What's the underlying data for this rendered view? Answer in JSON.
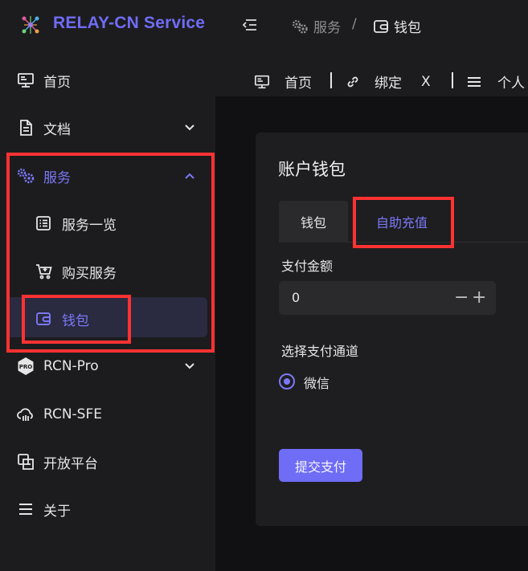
{
  "header": {
    "brand": "RELAY-CN Service",
    "breadcrumb": [
      {
        "label": "服务",
        "icon": "gears-icon"
      },
      {
        "label": "钱包",
        "icon": "wallet-icon"
      }
    ],
    "separator": "/"
  },
  "sidebar": {
    "items": [
      {
        "label": "首页",
        "icon": "monitor-icon"
      },
      {
        "label": "文档",
        "icon": "document-icon",
        "expanded": false
      },
      {
        "label": "服务",
        "icon": "gears-icon",
        "expanded": true,
        "highlighted": true
      },
      {
        "label": "服务一览",
        "icon": "list-icon",
        "sub": true
      },
      {
        "label": "购买服务",
        "icon": "cart-icon",
        "sub": true
      },
      {
        "label": "钱包",
        "icon": "wallet-icon",
        "sub": true,
        "active": true
      },
      {
        "label": "RCN-Pro",
        "icon": "pro-badge-icon",
        "expanded": false
      },
      {
        "label": "RCN-SFE",
        "icon": "cloud-icon"
      },
      {
        "label": "开放平台",
        "icon": "platform-icon"
      },
      {
        "label": "关于",
        "icon": "menu-icon"
      }
    ]
  },
  "tabs_bar": {
    "tabs": [
      {
        "label": "首页",
        "icon": "monitor-icon"
      },
      {
        "label": "绑定",
        "icon": "link-icon",
        "close": "X"
      },
      {
        "label": "个人",
        "icon": "menu-icon"
      }
    ]
  },
  "wallet": {
    "title": "账户钱包",
    "tabs": [
      "钱包",
      "自助充值"
    ],
    "active_tab": "自助充值",
    "amount_label": "支付金额",
    "amount_value": "0",
    "minus": "−",
    "plus": "+",
    "channel_label": "选择支付通道",
    "channel_option": "微信",
    "submit_label": "提交支付"
  },
  "colors": {
    "accent": "#6f6cf6",
    "highlight_box": "#ff3232",
    "background": "#1c1c1e"
  }
}
